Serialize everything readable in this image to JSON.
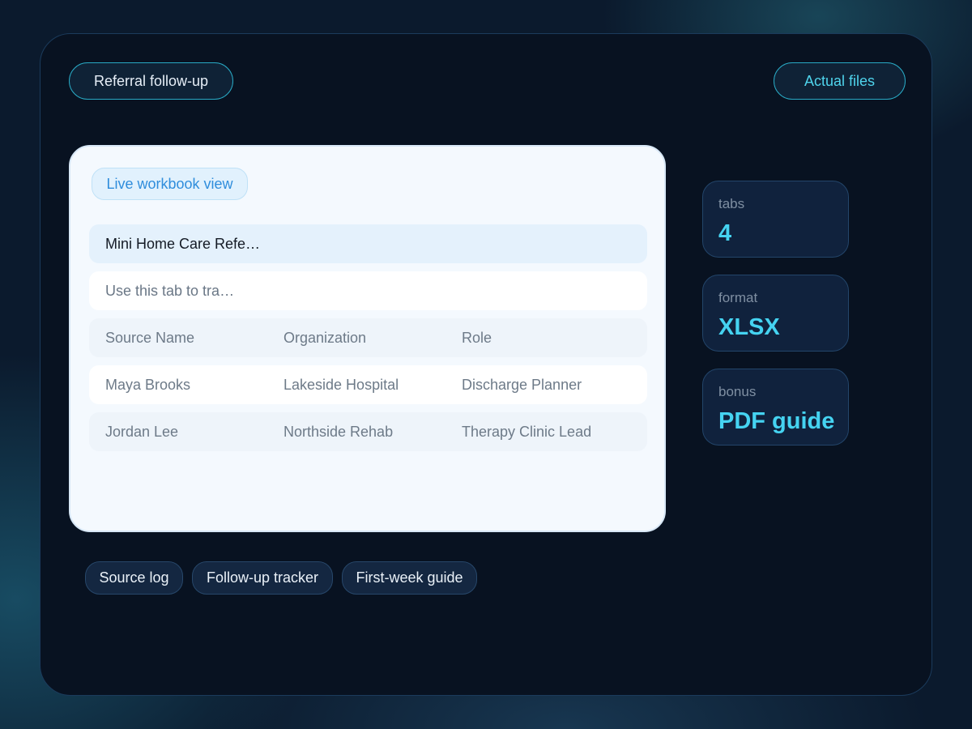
{
  "header": {
    "left_pill": "Referral follow-up",
    "right_pill": "Actual files"
  },
  "workbook": {
    "badge": "Live workbook view",
    "title": "Mini Home Care Refe…",
    "description": "Use this tab to tra…",
    "columns": [
      "Source Name",
      "Organization",
      "Role"
    ],
    "rows": [
      [
        "Maya Brooks",
        "Lakeside Hospital",
        "Discharge Planner"
      ],
      [
        "Jordan Lee",
        "Northside Rehab",
        "Therapy Clinic Lead"
      ]
    ]
  },
  "stats": [
    {
      "label": "tabs",
      "value": "4"
    },
    {
      "label": "format",
      "value": "XLSX"
    },
    {
      "label": "bonus",
      "value": "PDF guide"
    }
  ],
  "tabs": [
    "Source log",
    "Follow-up tracker",
    "First-week guide"
  ],
  "colors": {
    "accent": "#45d3f1",
    "panel_bg": "#081221",
    "card_bg": "#f4f9fe",
    "badge_text": "#2f8ddc"
  }
}
